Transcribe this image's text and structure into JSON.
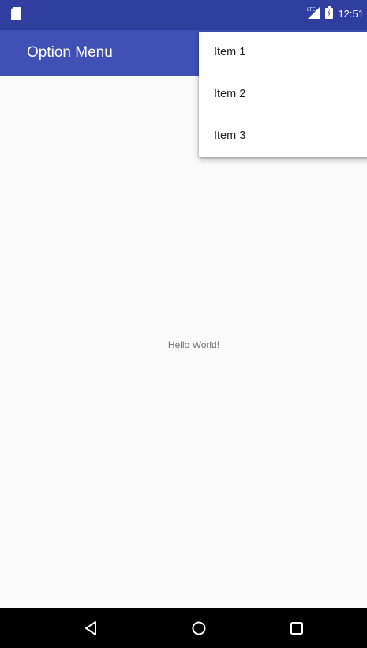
{
  "status_bar": {
    "time": "12:51",
    "network_label": "LTE",
    "icons": [
      "sd-card-icon",
      "signal-icon",
      "battery-icon"
    ],
    "background_color": "#303f9f"
  },
  "app_bar": {
    "title": "Option Menu",
    "background_color": "#3f51b5"
  },
  "content": {
    "text": "Hello World!"
  },
  "overflow_menu": {
    "items": [
      {
        "label": "Item 1"
      },
      {
        "label": "Item 2"
      },
      {
        "label": "Item 3"
      }
    ]
  },
  "nav_bar": {
    "buttons": [
      "back-icon",
      "home-icon",
      "recents-icon"
    ]
  }
}
